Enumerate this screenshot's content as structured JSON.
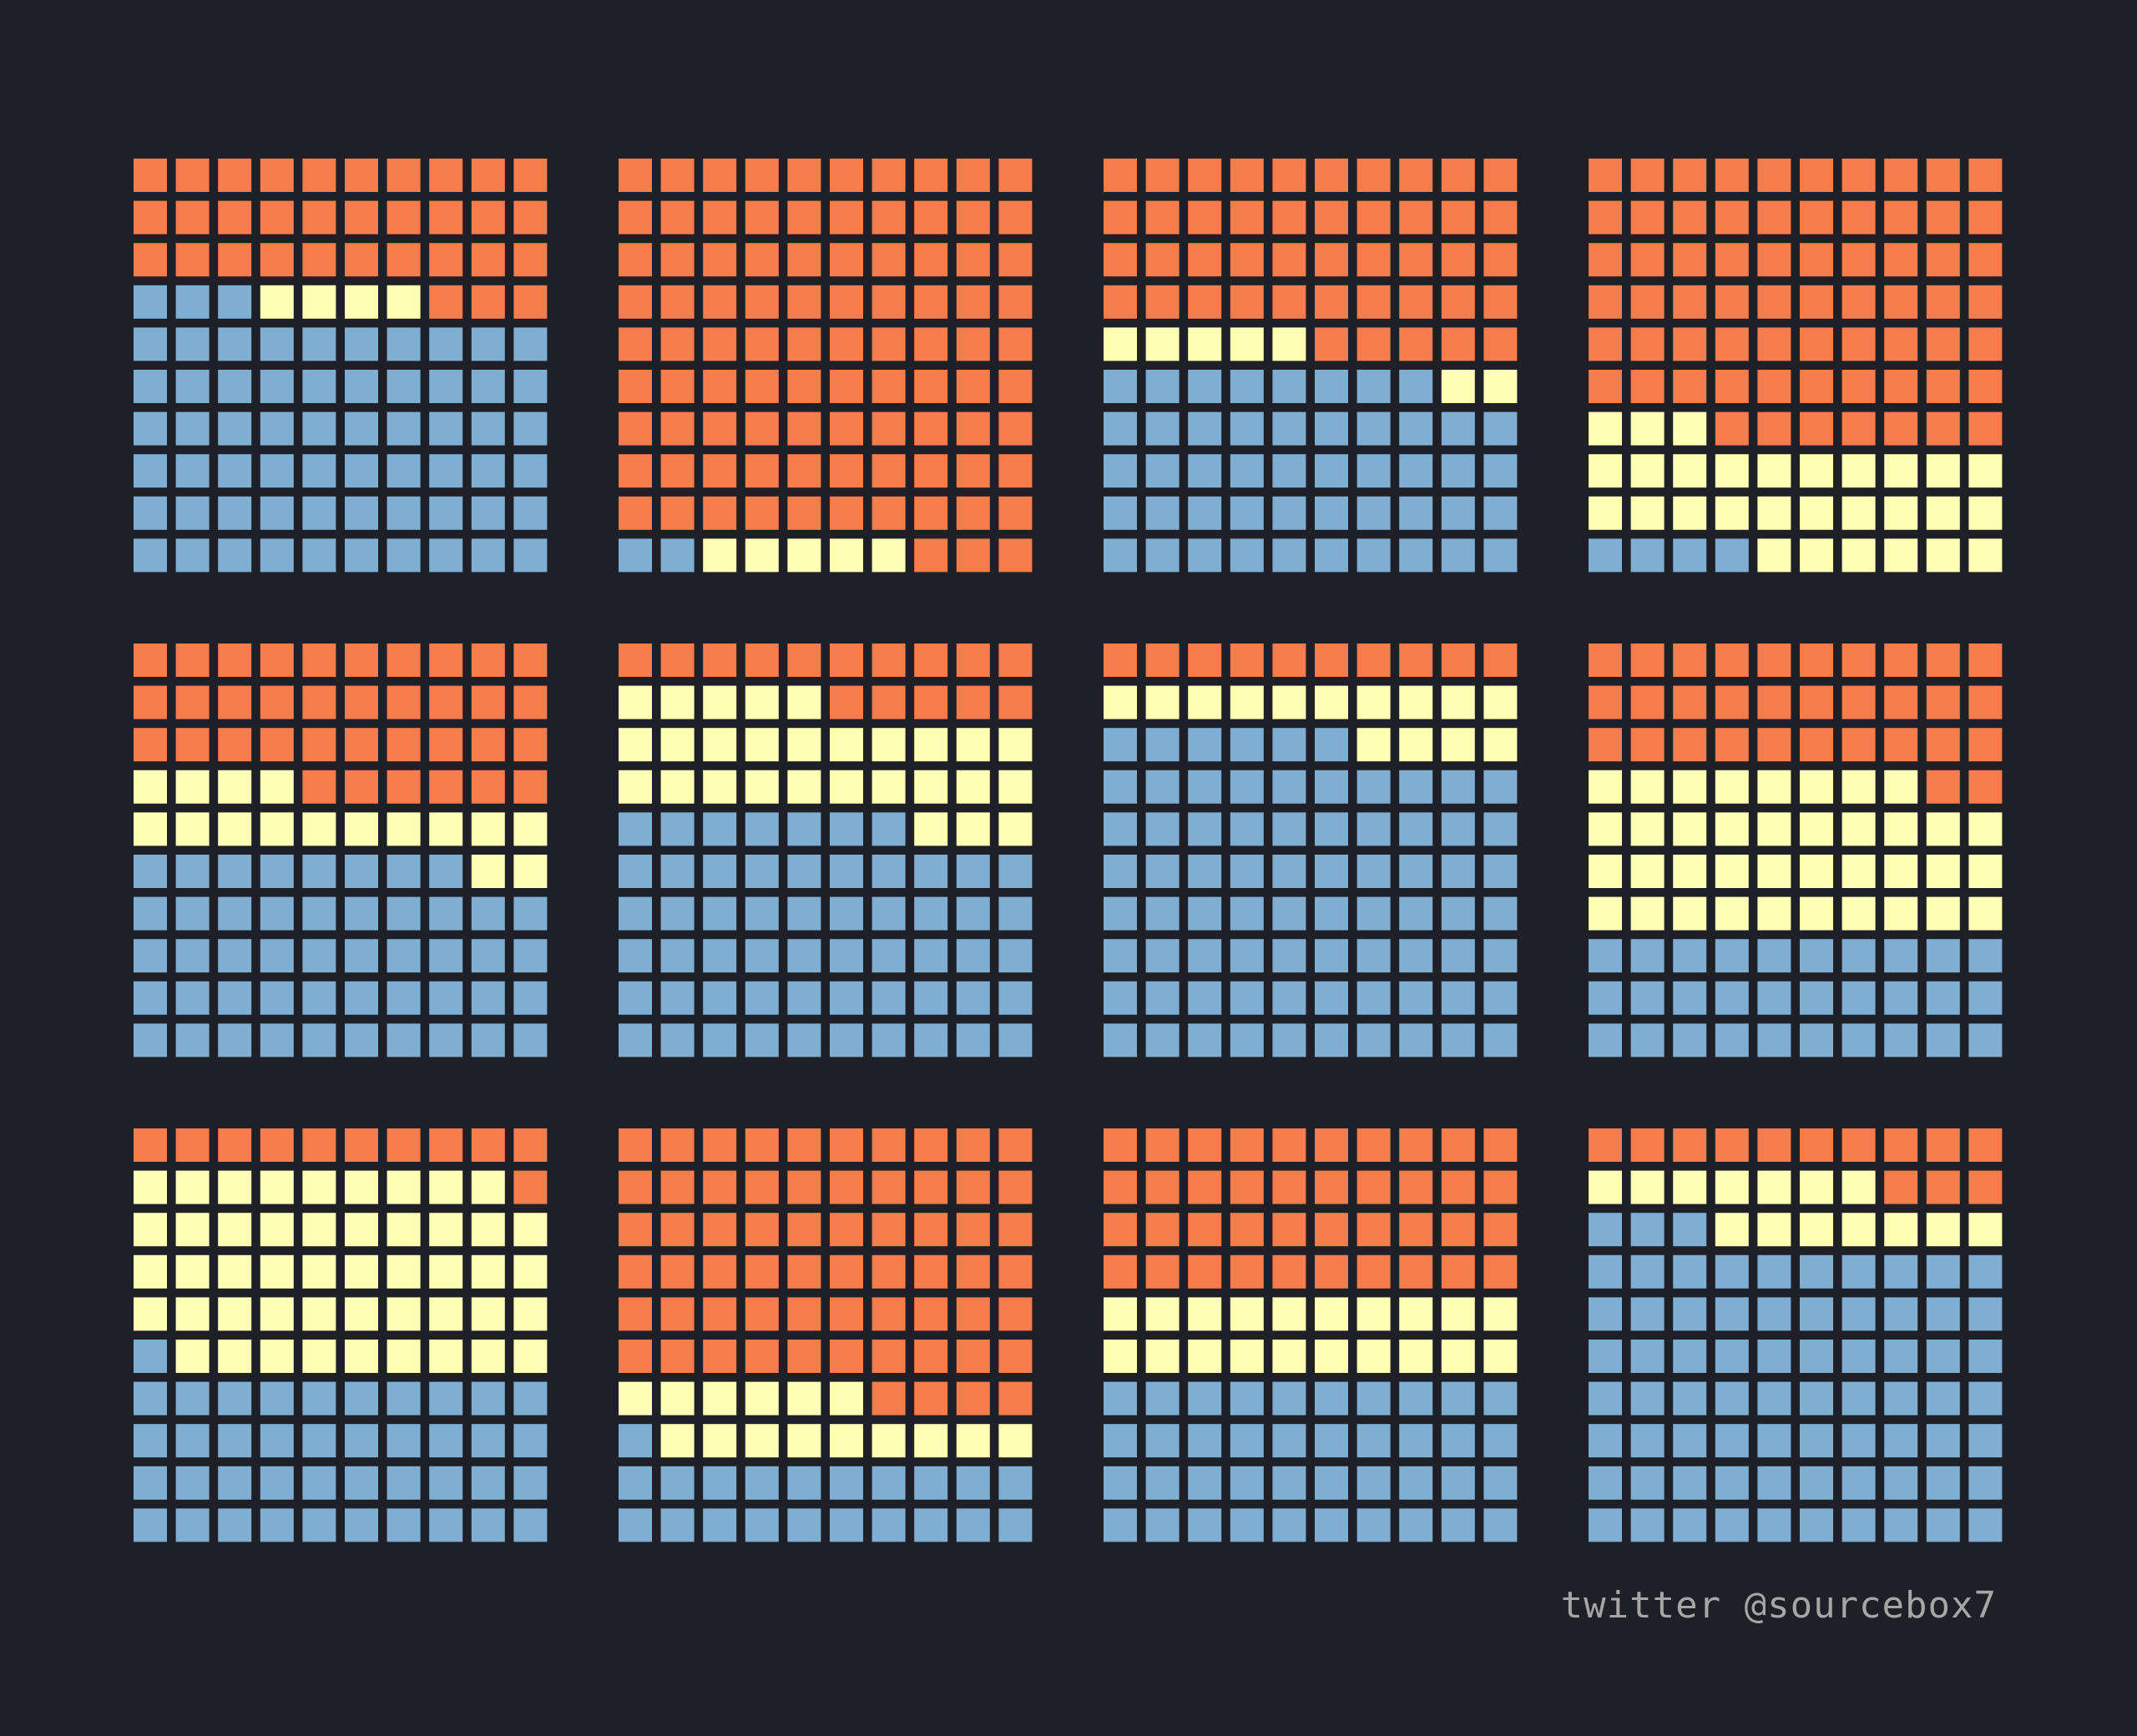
{
  "chart_data": {
    "type": "waffle",
    "colors": {
      "orange": "#f77c4b",
      "yellow": "#feffb4",
      "blue": "#7eafd3",
      "background": "#1f1f27"
    },
    "waffles": [
      {
        "orange": 33,
        "yellow": 4,
        "blue": 63
      },
      {
        "orange": 93,
        "yellow": 5,
        "blue": 2
      },
      {
        "orange": 45,
        "yellow": 7,
        "blue": 48
      },
      {
        "orange": 67,
        "yellow": 29,
        "blue": 4
      },
      {
        "orange": 36,
        "yellow": 16,
        "blue": 48
      },
      {
        "orange": 15,
        "yellow": 28,
        "blue": 57
      },
      {
        "orange": 10,
        "yellow": 14,
        "blue": 76
      },
      {
        "orange": 32,
        "yellow": 38,
        "blue": 30
      },
      {
        "orange": 11,
        "yellow": 48,
        "blue": 41
      },
      {
        "orange": 64,
        "yellow": 15,
        "blue": 21
      },
      {
        "orange": 40,
        "yellow": 20,
        "blue": 40
      },
      {
        "orange": 13,
        "yellow": 14,
        "blue": 73
      }
    ]
  },
  "credit": "twitter @sourcebox7"
}
